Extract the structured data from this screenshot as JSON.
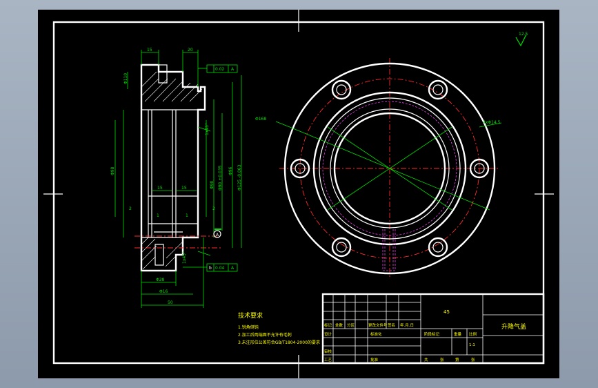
{
  "colors": {
    "background": "#000000",
    "frame": "#ffffff",
    "dimension": "#00e000",
    "centerline": "#ff2a2a",
    "hidden": "#e040e0",
    "notes": "#ffff00"
  },
  "roughness": "12.5",
  "technical_requirements": {
    "title": "技术要求",
    "items": [
      "1.锐角倒钝",
      "2.加工后两端面不允许有毛刺",
      "3.未注形位公差符合GB/T1804-2000的要求"
    ]
  },
  "title_block": {
    "part_name": "升降气盖",
    "grid_row1": [
      "标记",
      "处数",
      "分区",
      "更改文件号",
      "签名",
      "年.月.日"
    ],
    "grid_row2": [
      "设计",
      "",
      "",
      "标准化"
    ],
    "grid_row3": [
      "审核"
    ],
    "grid_row4": [
      "工艺",
      "",
      "",
      "批准"
    ],
    "stage_label": "阶段标记",
    "weight_label": "重量",
    "scale_label": "比例",
    "scale_value": "1:1",
    "sheet_row": [
      "共",
      "张",
      "第",
      "张"
    ],
    "material_mark": "45"
  },
  "section_view": {
    "dims_top": [
      "15",
      "20"
    ],
    "dims_left": [
      "Φ110",
      "Φ98"
    ],
    "dims_right": [
      "Φ90",
      "Φ90 +0.035",
      "Φ96",
      "Φ125 -0.063"
    ],
    "dims_inner": [
      "15",
      "15",
      "2",
      "2",
      "1",
      "1"
    ],
    "chamfer": "1x45°",
    "tolerance_top": [
      "0.02",
      "A"
    ],
    "tolerance_bottom": [
      "0.04",
      "A"
    ],
    "datum_top": "A",
    "datum_bottom": "b",
    "dims_bottom": [
      "Φ28",
      "Φ16",
      "50"
    ]
  },
  "front_view": {
    "dim_left": "Φ168",
    "dim_right": "4xΦ14.5"
  }
}
